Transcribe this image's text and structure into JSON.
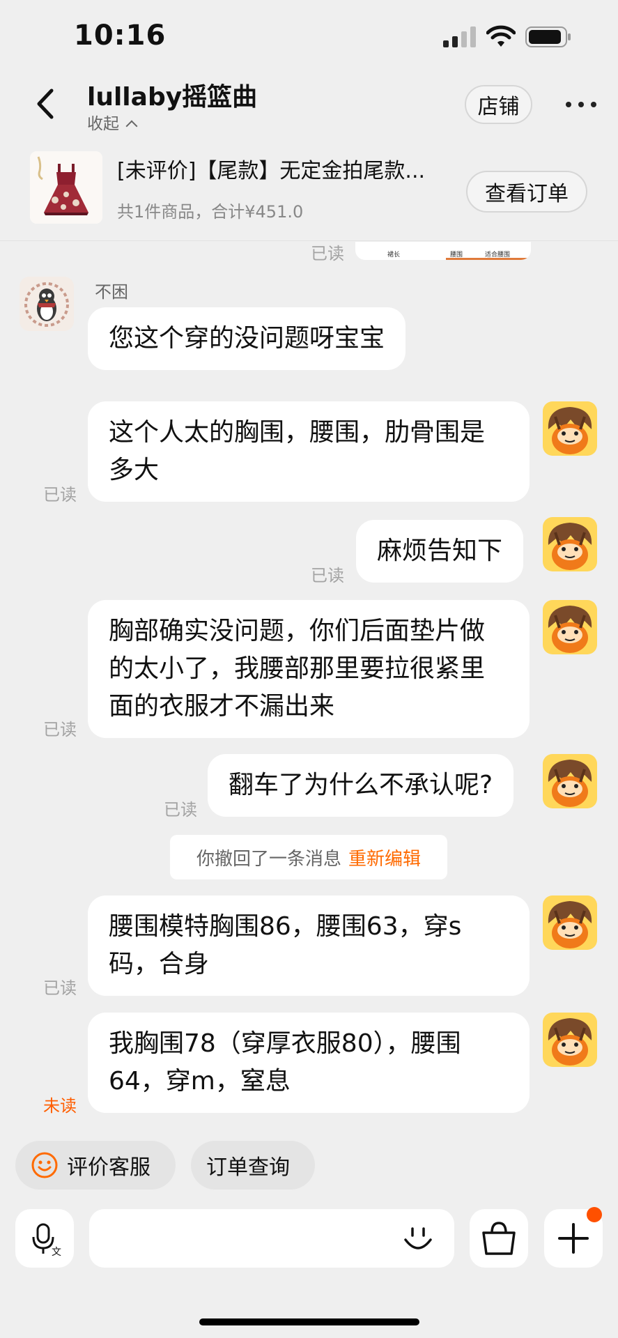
{
  "status": {
    "time": "10:16"
  },
  "header": {
    "title": "lullaby摇篮曲",
    "collapse_label": "收起",
    "shop_label": "店铺"
  },
  "order": {
    "title": "[未评价]【尾款】无定金拍尾款...",
    "summary": "共1件商品，合计¥451.0",
    "view_label": "查看订单"
  },
  "size_chart_labels": [
    "裙长",
    "腰围",
    "适合腰围"
  ],
  "chat": {
    "top_read": "已读",
    "other_name": "不困",
    "messages": [
      {
        "from": "other",
        "text": "您这个穿的没问题呀宝宝"
      },
      {
        "from": "me",
        "text": "这个人太的胸围，腰围，肋骨围是多大",
        "status": "已读"
      },
      {
        "from": "me",
        "text": "麻烦告知下",
        "status": "已读"
      },
      {
        "from": "me",
        "text": "胸部确实没问题，你们后面垫片做的太小了，我腰部那里要拉很紧里面的衣服才不漏出来",
        "status": "已读"
      },
      {
        "from": "me",
        "text": "翻车了为什么不承认呢?",
        "status": "已读"
      },
      {
        "from": "me",
        "text": "腰围模特胸围86，腰围63，穿s码，合身",
        "status": "已读"
      },
      {
        "from": "me",
        "text": "我胸围78（穿厚衣服80），腰围64，穿m，窒息",
        "status": "未读"
      }
    ],
    "system": {
      "text": "你撤回了一条消息",
      "action": "重新编辑"
    }
  },
  "quick_actions": [
    {
      "label": "评价客服",
      "icon": "smile-icon"
    },
    {
      "label": "订单查询"
    }
  ],
  "colors": {
    "accent": "#ff6a00",
    "background": "#efefef",
    "bubble": "#ffffff"
  }
}
